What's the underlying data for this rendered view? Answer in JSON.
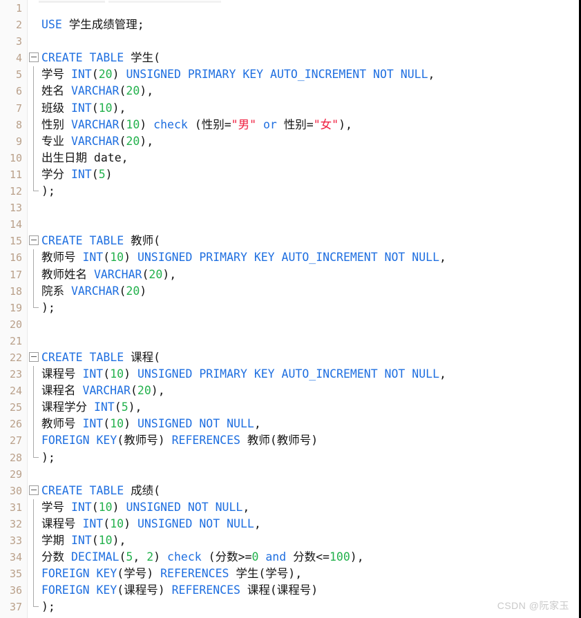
{
  "editor": {
    "kind": "sql-code-editor",
    "language": "SQL",
    "total_lines": 37,
    "colors": {
      "background": "#ffffff",
      "gutter_background": "#fafafa",
      "line_number": "#b9a08a",
      "keyword": "#1f6fe0",
      "number": "#22b14c",
      "string": "#ef2040",
      "plain_text": "#141414",
      "fold_marker_border": "#9a9a9a",
      "indent_guide": "#a9a9a9",
      "watermark": "#c9c9c9"
    }
  },
  "watermark": {
    "text": "CSDN @阮家玉"
  },
  "fold_markers": [
    {
      "line": 4,
      "state": "expanded",
      "glyph": "minus"
    },
    {
      "line": 15,
      "state": "expanded",
      "glyph": "minus"
    },
    {
      "line": 22,
      "state": "expanded",
      "glyph": "minus"
    },
    {
      "line": 30,
      "state": "expanded",
      "glyph": "minus"
    }
  ],
  "fold_regions": [
    {
      "start": 4,
      "end": 12
    },
    {
      "start": 15,
      "end": 19
    },
    {
      "start": 22,
      "end": 28
    },
    {
      "start": 30,
      "end": 37
    }
  ],
  "lines": [
    {
      "n": 1,
      "tokens": []
    },
    {
      "n": 2,
      "tokens": [
        {
          "t": "USE ",
          "c": "kw"
        },
        {
          "t": "学生成绩管理;",
          "c": "plain"
        }
      ]
    },
    {
      "n": 3,
      "tokens": []
    },
    {
      "n": 4,
      "tokens": [
        {
          "t": "CREATE TABLE ",
          "c": "kw"
        },
        {
          "t": "学生(",
          "c": "plain"
        }
      ]
    },
    {
      "n": 5,
      "tokens": [
        {
          "t": "学号 ",
          "c": "plain"
        },
        {
          "t": "INT",
          "c": "kw"
        },
        {
          "t": "(",
          "c": "plain"
        },
        {
          "t": "20",
          "c": "num"
        },
        {
          "t": ") ",
          "c": "plain"
        },
        {
          "t": "UNSIGNED PRIMARY KEY AUTO_INCREMENT NOT NULL",
          "c": "kw"
        },
        {
          "t": ",",
          "c": "plain"
        }
      ]
    },
    {
      "n": 6,
      "tokens": [
        {
          "t": "姓名 ",
          "c": "plain"
        },
        {
          "t": "VARCHAR",
          "c": "kw"
        },
        {
          "t": "(",
          "c": "plain"
        },
        {
          "t": "20",
          "c": "num"
        },
        {
          "t": "),",
          "c": "plain"
        }
      ]
    },
    {
      "n": 7,
      "tokens": [
        {
          "t": "班级 ",
          "c": "plain"
        },
        {
          "t": "INT",
          "c": "kw"
        },
        {
          "t": "(",
          "c": "plain"
        },
        {
          "t": "10",
          "c": "num"
        },
        {
          "t": "),",
          "c": "plain"
        }
      ]
    },
    {
      "n": 8,
      "tokens": [
        {
          "t": "性别 ",
          "c": "plain"
        },
        {
          "t": "VARCHAR",
          "c": "kw"
        },
        {
          "t": "(",
          "c": "plain"
        },
        {
          "t": "10",
          "c": "num"
        },
        {
          "t": ") ",
          "c": "plain"
        },
        {
          "t": "check",
          "c": "kw"
        },
        {
          "t": " (性别=",
          "c": "plain"
        },
        {
          "t": "\"男\"",
          "c": "str"
        },
        {
          "t": " ",
          "c": "plain"
        },
        {
          "t": "or",
          "c": "kw"
        },
        {
          "t": " 性别=",
          "c": "plain"
        },
        {
          "t": "\"女\"",
          "c": "str"
        },
        {
          "t": "),",
          "c": "plain"
        }
      ]
    },
    {
      "n": 9,
      "tokens": [
        {
          "t": "专业 ",
          "c": "plain"
        },
        {
          "t": "VARCHAR",
          "c": "kw"
        },
        {
          "t": "(",
          "c": "plain"
        },
        {
          "t": "20",
          "c": "num"
        },
        {
          "t": "),",
          "c": "plain"
        }
      ]
    },
    {
      "n": 10,
      "tokens": [
        {
          "t": "出生日期 date,",
          "c": "plain"
        }
      ]
    },
    {
      "n": 11,
      "tokens": [
        {
          "t": "学分 ",
          "c": "plain"
        },
        {
          "t": "INT",
          "c": "kw"
        },
        {
          "t": "(",
          "c": "plain"
        },
        {
          "t": "5",
          "c": "num"
        },
        {
          "t": ")",
          "c": "plain"
        }
      ]
    },
    {
      "n": 12,
      "tokens": [
        {
          "t": ");",
          "c": "plain"
        }
      ]
    },
    {
      "n": 13,
      "tokens": []
    },
    {
      "n": 14,
      "tokens": []
    },
    {
      "n": 15,
      "tokens": [
        {
          "t": "CREATE TABLE ",
          "c": "kw"
        },
        {
          "t": "教师(",
          "c": "plain"
        }
      ]
    },
    {
      "n": 16,
      "tokens": [
        {
          "t": "教师号 ",
          "c": "plain"
        },
        {
          "t": "INT",
          "c": "kw"
        },
        {
          "t": "(",
          "c": "plain"
        },
        {
          "t": "10",
          "c": "num"
        },
        {
          "t": ") ",
          "c": "plain"
        },
        {
          "t": "UNSIGNED PRIMARY KEY AUTO_INCREMENT NOT NULL",
          "c": "kw"
        },
        {
          "t": ",",
          "c": "plain"
        }
      ]
    },
    {
      "n": 17,
      "tokens": [
        {
          "t": "教师姓名 ",
          "c": "plain"
        },
        {
          "t": "VARCHAR",
          "c": "kw"
        },
        {
          "t": "(",
          "c": "plain"
        },
        {
          "t": "20",
          "c": "num"
        },
        {
          "t": "),",
          "c": "plain"
        }
      ]
    },
    {
      "n": 18,
      "tokens": [
        {
          "t": "院系 ",
          "c": "plain"
        },
        {
          "t": "VARCHAR",
          "c": "kw"
        },
        {
          "t": "(",
          "c": "plain"
        },
        {
          "t": "20",
          "c": "num"
        },
        {
          "t": ")",
          "c": "plain"
        }
      ]
    },
    {
      "n": 19,
      "tokens": [
        {
          "t": ");",
          "c": "plain"
        }
      ]
    },
    {
      "n": 20,
      "tokens": []
    },
    {
      "n": 21,
      "tokens": []
    },
    {
      "n": 22,
      "tokens": [
        {
          "t": "CREATE TABLE ",
          "c": "kw"
        },
        {
          "t": "课程(",
          "c": "plain"
        }
      ]
    },
    {
      "n": 23,
      "tokens": [
        {
          "t": "课程号 ",
          "c": "plain"
        },
        {
          "t": "INT",
          "c": "kw"
        },
        {
          "t": "(",
          "c": "plain"
        },
        {
          "t": "10",
          "c": "num"
        },
        {
          "t": ") ",
          "c": "plain"
        },
        {
          "t": "UNSIGNED PRIMARY KEY AUTO_INCREMENT NOT NULL",
          "c": "kw"
        },
        {
          "t": ",",
          "c": "plain"
        }
      ]
    },
    {
      "n": 24,
      "tokens": [
        {
          "t": "课程名 ",
          "c": "plain"
        },
        {
          "t": "VARCHAR",
          "c": "kw"
        },
        {
          "t": "(",
          "c": "plain"
        },
        {
          "t": "20",
          "c": "num"
        },
        {
          "t": "),",
          "c": "plain"
        }
      ]
    },
    {
      "n": 25,
      "tokens": [
        {
          "t": "课程学分 ",
          "c": "plain"
        },
        {
          "t": "INT",
          "c": "kw"
        },
        {
          "t": "(",
          "c": "plain"
        },
        {
          "t": "5",
          "c": "num"
        },
        {
          "t": "),",
          "c": "plain"
        }
      ]
    },
    {
      "n": 26,
      "tokens": [
        {
          "t": "教师号 ",
          "c": "plain"
        },
        {
          "t": "INT",
          "c": "kw"
        },
        {
          "t": "(",
          "c": "plain"
        },
        {
          "t": "10",
          "c": "num"
        },
        {
          "t": ") ",
          "c": "plain"
        },
        {
          "t": "UNSIGNED NOT NULL",
          "c": "kw"
        },
        {
          "t": ",",
          "c": "plain"
        }
      ]
    },
    {
      "n": 27,
      "tokens": [
        {
          "t": "FOREIGN KEY",
          "c": "kw"
        },
        {
          "t": "(教师号) ",
          "c": "plain"
        },
        {
          "t": "REFERENCES",
          "c": "kw"
        },
        {
          "t": " 教师(教师号)",
          "c": "plain"
        }
      ]
    },
    {
      "n": 28,
      "tokens": [
        {
          "t": ");",
          "c": "plain"
        }
      ]
    },
    {
      "n": 29,
      "tokens": []
    },
    {
      "n": 30,
      "tokens": [
        {
          "t": "CREATE TABLE ",
          "c": "kw"
        },
        {
          "t": "成绩(",
          "c": "plain"
        }
      ]
    },
    {
      "n": 31,
      "tokens": [
        {
          "t": "学号 ",
          "c": "plain"
        },
        {
          "t": "INT",
          "c": "kw"
        },
        {
          "t": "(",
          "c": "plain"
        },
        {
          "t": "10",
          "c": "num"
        },
        {
          "t": ") ",
          "c": "plain"
        },
        {
          "t": "UNSIGNED NOT NULL",
          "c": "kw"
        },
        {
          "t": ",",
          "c": "plain"
        }
      ]
    },
    {
      "n": 32,
      "tokens": [
        {
          "t": "课程号 ",
          "c": "plain"
        },
        {
          "t": "INT",
          "c": "kw"
        },
        {
          "t": "(",
          "c": "plain"
        },
        {
          "t": "10",
          "c": "num"
        },
        {
          "t": ") ",
          "c": "plain"
        },
        {
          "t": "UNSIGNED NOT NULL",
          "c": "kw"
        },
        {
          "t": ",",
          "c": "plain"
        }
      ]
    },
    {
      "n": 33,
      "tokens": [
        {
          "t": "学期 ",
          "c": "plain"
        },
        {
          "t": "INT",
          "c": "kw"
        },
        {
          "t": "(",
          "c": "plain"
        },
        {
          "t": "10",
          "c": "num"
        },
        {
          "t": "),",
          "c": "plain"
        }
      ]
    },
    {
      "n": 34,
      "tokens": [
        {
          "t": "分数 ",
          "c": "plain"
        },
        {
          "t": "DECIMAL",
          "c": "kw"
        },
        {
          "t": "(",
          "c": "plain"
        },
        {
          "t": "5",
          "c": "num"
        },
        {
          "t": ", ",
          "c": "plain"
        },
        {
          "t": "2",
          "c": "num"
        },
        {
          "t": ") ",
          "c": "plain"
        },
        {
          "t": "check",
          "c": "kw"
        },
        {
          "t": " (分数>=",
          "c": "plain"
        },
        {
          "t": "0",
          "c": "num"
        },
        {
          "t": " ",
          "c": "plain"
        },
        {
          "t": "and",
          "c": "kw"
        },
        {
          "t": " 分数<=",
          "c": "plain"
        },
        {
          "t": "100",
          "c": "num"
        },
        {
          "t": "),",
          "c": "plain"
        }
      ]
    },
    {
      "n": 35,
      "tokens": [
        {
          "t": "FOREIGN KEY",
          "c": "kw"
        },
        {
          "t": "(学号) ",
          "c": "plain"
        },
        {
          "t": "REFERENCES",
          "c": "kw"
        },
        {
          "t": " 学生(学号),",
          "c": "plain"
        }
      ]
    },
    {
      "n": 36,
      "tokens": [
        {
          "t": "FOREIGN KEY",
          "c": "kw"
        },
        {
          "t": "(课程号) ",
          "c": "plain"
        },
        {
          "t": "REFERENCES",
          "c": "kw"
        },
        {
          "t": " 课程(课程号)",
          "c": "plain"
        }
      ]
    },
    {
      "n": 37,
      "tokens": [
        {
          "t": ");",
          "c": "plain"
        }
      ]
    }
  ]
}
